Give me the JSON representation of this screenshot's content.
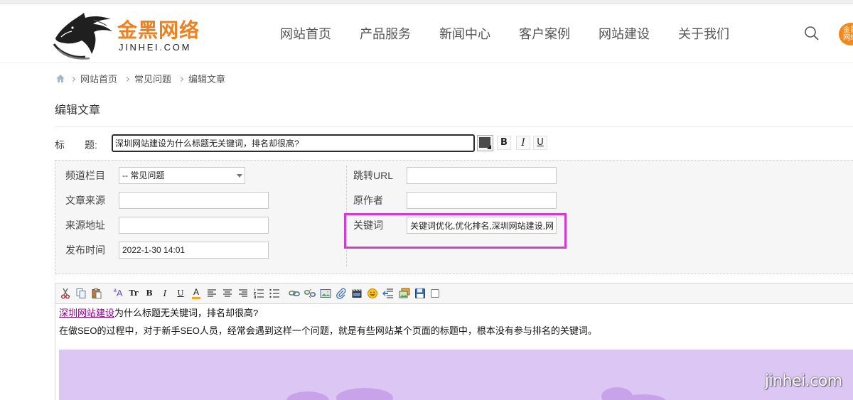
{
  "theme": {
    "brand_orange": "#f07f1d",
    "highlight_magenta": "#d33bd3",
    "link_color": "#800080",
    "image_lavender": "#dcc6f3"
  },
  "header": {
    "logo": {
      "icon": "horse-logo-icon",
      "brand_cn": "金黑网络",
      "brand_en": "JINHEI.COM"
    },
    "nav": [
      {
        "label": "网站首页"
      },
      {
        "label": "产品服务"
      },
      {
        "label": "新闻中心"
      },
      {
        "label": "客户案例"
      },
      {
        "label": "网站建设"
      },
      {
        "label": "关于我们"
      }
    ],
    "search_icon": "search-icon",
    "badge": {
      "line1": "金黑",
      "line2": "网络"
    }
  },
  "breadcrumb": {
    "home_icon": "home-icon",
    "separator_icon": "chevron-right-icon",
    "items": [
      "网站首页",
      "常见问题",
      "编辑文章"
    ]
  },
  "page_title": "编辑文章",
  "form": {
    "title": {
      "label": "标　　题:",
      "value": "深圳网站建设为什么标题无关键词，排名却很高?",
      "color_picker_icon": "color-picker-icon",
      "bold_label": "B",
      "italic_label": "I",
      "underline_label": "U"
    },
    "meta": {
      "channel": {
        "label": "频道栏目",
        "value": "-- 常见问题"
      },
      "source": {
        "label": "文章来源",
        "value": ""
      },
      "source_url": {
        "label": "来源地址",
        "value": ""
      },
      "publish_time": {
        "label": "发布时间",
        "value": "2022-1-30 14:01"
      },
      "redirect_url": {
        "label": "跳转URL",
        "value": ""
      },
      "author": {
        "label": "原作者",
        "value": ""
      },
      "keywords": {
        "label": "关键词",
        "value": "关键词优化,优化排名,深圳网站建设,网",
        "highlighted": true
      }
    }
  },
  "editor": {
    "toolbar": [
      {
        "icon": "cut-icon"
      },
      {
        "icon": "copy-icon"
      },
      {
        "icon": "paste-icon"
      },
      {
        "icon": "font-size-icon",
        "glyph_small": "a",
        "glyph": "A"
      },
      {
        "icon": "font-style-icon",
        "glyph": "Tr"
      },
      {
        "icon": "bold-icon",
        "glyph": "B"
      },
      {
        "icon": "italic-icon",
        "glyph": "I"
      },
      {
        "icon": "underline-icon",
        "glyph": "U"
      },
      {
        "icon": "font-color-icon",
        "glyph": "A"
      },
      {
        "icon": "align-left-icon"
      },
      {
        "icon": "align-center-icon"
      },
      {
        "icon": "align-right-icon"
      },
      {
        "icon": "ordered-list-icon"
      },
      {
        "icon": "unordered-list-icon"
      },
      {
        "icon": "link-icon"
      },
      {
        "icon": "unlink-icon"
      },
      {
        "icon": "image-icon"
      },
      {
        "icon": "attachment-icon"
      },
      {
        "icon": "video-icon"
      },
      {
        "icon": "emoji-icon"
      },
      {
        "icon": "insert-layer-icon"
      },
      {
        "icon": "gallery-icon"
      },
      {
        "icon": "save-icon"
      },
      {
        "icon": "checkbox-icon"
      }
    ],
    "content": {
      "line1_link": "深圳网站建设",
      "line1_rest": "为什么标题无关键词，排名却很高?",
      "line2": "在做SEO的过程中，对于新手SEO人员，经常会遇到这样一个问题，就是有些网站某个页面的标题中，根本没有参与排名的关键词。"
    }
  },
  "watermark": "jinhei.com"
}
